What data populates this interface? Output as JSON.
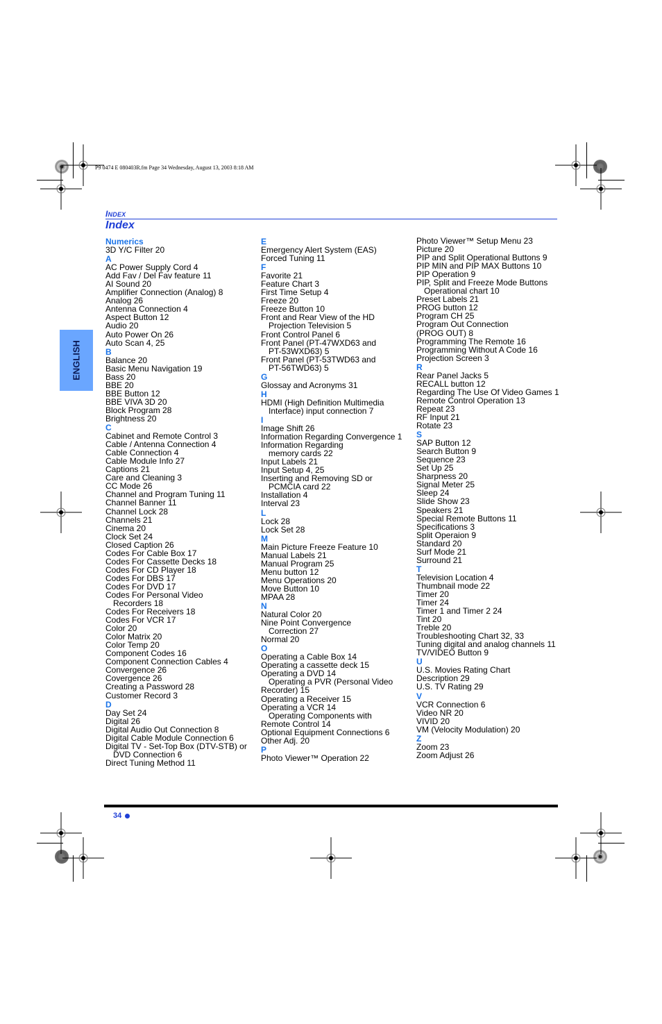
{
  "print_info": "P9 0474 E  080403R.fm  Page 34  Wednesday, August 13, 2003  8:18 AM",
  "header": {
    "section_label_initial": "I",
    "section_label_rest": "NDEX",
    "title": "Index"
  },
  "side_tab": {
    "label": "ENGLISH"
  },
  "colors": {
    "accent_blue": "#1f3fd6",
    "letter_blue": "#1a73e8",
    "tab_blue": "#6aa6ff"
  },
  "columns": [
    [
      {
        "t": "letter",
        "text": "Numerics"
      },
      {
        "t": "entry",
        "text": "3D Y/C Filter 20"
      },
      {
        "t": "letter",
        "text": "A"
      },
      {
        "t": "entry",
        "text": "AC Power Supply Cord 4"
      },
      {
        "t": "entry",
        "text": "Add Fav / Del Fav feature 11"
      },
      {
        "t": "entry",
        "text": "AI Sound 20"
      },
      {
        "t": "entry",
        "text": "Amplifier Connection (Analog) 8"
      },
      {
        "t": "entry",
        "text": "Analog 26"
      },
      {
        "t": "entry",
        "text": "Antenna Connection 4"
      },
      {
        "t": "entry",
        "text": "Aspect Button 12"
      },
      {
        "t": "entry",
        "text": "Audio 20"
      },
      {
        "t": "entry",
        "text": "Auto Power On 26"
      },
      {
        "t": "entry",
        "text": "Auto Scan 4, 25"
      },
      {
        "t": "letter",
        "text": "B"
      },
      {
        "t": "entry",
        "text": "Balance 20"
      },
      {
        "t": "entry",
        "text": "Basic Menu Navigation 19"
      },
      {
        "t": "entry",
        "text": "Bass 20"
      },
      {
        "t": "entry",
        "text": "BBE 20"
      },
      {
        "t": "entry",
        "text": "BBE Button 12"
      },
      {
        "t": "entry",
        "text": "BBE VIVA 3D 20"
      },
      {
        "t": "entry",
        "text": "Block Program 28"
      },
      {
        "t": "entry",
        "text": "Brightness 20"
      },
      {
        "t": "letter",
        "text": "C"
      },
      {
        "t": "entry",
        "text": "Cabinet and Remote Control 3"
      },
      {
        "t": "entry",
        "text": "Cable / Antenna Connection 4"
      },
      {
        "t": "entry",
        "text": "Cable Connection 4"
      },
      {
        "t": "entry",
        "text": "Cable Module Info 27"
      },
      {
        "t": "entry",
        "text": "Captions 21"
      },
      {
        "t": "entry",
        "text": "Care and Cleaning 3"
      },
      {
        "t": "entry",
        "text": "CC Mode 26"
      },
      {
        "t": "entry",
        "text": "Channel and Program Tuning 11"
      },
      {
        "t": "entry",
        "text": "Channel Banner 11"
      },
      {
        "t": "entry",
        "text": "Channel Lock 28"
      },
      {
        "t": "entry",
        "text": "Channels 21"
      },
      {
        "t": "entry",
        "text": "Cinema 20"
      },
      {
        "t": "entry",
        "text": "Clock Set 24"
      },
      {
        "t": "entry",
        "text": "Closed Caption 26"
      },
      {
        "t": "entry",
        "text": "Codes For Cable Box 17"
      },
      {
        "t": "entry",
        "text": "Codes For Cassette Decks 18"
      },
      {
        "t": "entry",
        "text": "Codes For CD Player 18"
      },
      {
        "t": "entry",
        "text": "Codes For DBS 17"
      },
      {
        "t": "entry",
        "text": "Codes For DVD 17"
      },
      {
        "t": "entry",
        "text": "Codes For Personal Video"
      },
      {
        "t": "cont",
        "text": "Recorders 18"
      },
      {
        "t": "entry",
        "text": "Codes For Receivers 18"
      },
      {
        "t": "entry",
        "text": "Codes For VCR 17"
      },
      {
        "t": "entry",
        "text": "Color 20"
      },
      {
        "t": "entry",
        "text": "Color Matrix 20"
      },
      {
        "t": "entry",
        "text": "Color Temp 20"
      },
      {
        "t": "entry",
        "text": "Component Codes 16"
      },
      {
        "t": "entry",
        "text": "Component Connection Cables 4"
      },
      {
        "t": "entry",
        "text": "Convergence 26"
      },
      {
        "t": "entry",
        "text": "Covergence 26"
      },
      {
        "t": "entry",
        "text": "Creating a Password 28"
      },
      {
        "t": "entry",
        "text": "Customer Record 3"
      },
      {
        "t": "letter",
        "text": "D"
      },
      {
        "t": "entry",
        "text": "Day Set 24"
      },
      {
        "t": "entry",
        "text": "Digital 26"
      },
      {
        "t": "entry",
        "text": "Digital Audio Out Connection 8"
      },
      {
        "t": "entry",
        "text": "Digital Cable Module Connection 6"
      },
      {
        "t": "entry",
        "text": "Digital TV - Set-Top Box (DTV-STB) or"
      },
      {
        "t": "cont",
        "text": "DVD Connection 6"
      },
      {
        "t": "entry",
        "text": "Direct Tuning Method 11"
      }
    ],
    [
      {
        "t": "letter",
        "text": "E"
      },
      {
        "t": "entry",
        "text": "Emergency Alert System (EAS)"
      },
      {
        "t": "entry",
        "text": "Forced Tuning 11"
      },
      {
        "t": "letter",
        "text": "F"
      },
      {
        "t": "entry",
        "text": "Favorite 21"
      },
      {
        "t": "entry",
        "text": "Feature Chart 3"
      },
      {
        "t": "entry",
        "text": "First Time Setup 4"
      },
      {
        "t": "entry",
        "text": "Freeze 20"
      },
      {
        "t": "entry",
        "text": "Freeze Button 10"
      },
      {
        "t": "entry",
        "text": "Front and Rear View of the HD"
      },
      {
        "t": "cont",
        "text": "Projection Television 5"
      },
      {
        "t": "entry",
        "text": "Front Control Panel 6"
      },
      {
        "t": "entry",
        "text": "Front Panel (PT-47WXD63 and"
      },
      {
        "t": "cont",
        "text": "PT-53WXD63) 5"
      },
      {
        "t": "entry",
        "text": "Front Panel (PT-53TWD63 and"
      },
      {
        "t": "cont",
        "text": "PT-56TWD63) 5"
      },
      {
        "t": "letter",
        "text": "G"
      },
      {
        "t": "entry",
        "text": "Glossay and Acronyms 31"
      },
      {
        "t": "letter",
        "text": "H"
      },
      {
        "t": "entry",
        "text": "HDMI (High Definition Multimedia"
      },
      {
        "t": "cont",
        "text": "Interface) input connection 7"
      },
      {
        "t": "letter",
        "text": "I"
      },
      {
        "t": "entry",
        "text": "Image Shift 26"
      },
      {
        "t": "entry",
        "text": "Information Regarding Convergence 1"
      },
      {
        "t": "entry",
        "text": "Information Regarding"
      },
      {
        "t": "cont",
        "text": "memory cards 22"
      },
      {
        "t": "entry",
        "text": "Input Labels 21"
      },
      {
        "t": "entry",
        "text": "Input Setup 4, 25"
      },
      {
        "t": "entry",
        "text": "Inserting and Removing SD or"
      },
      {
        "t": "cont",
        "text": "PCMCIA card 22"
      },
      {
        "t": "entry",
        "text": "Installation 4"
      },
      {
        "t": "entry",
        "text": "Interval 23"
      },
      {
        "t": "letter",
        "text": "L"
      },
      {
        "t": "entry",
        "text": "Lock 28"
      },
      {
        "t": "entry",
        "text": "Lock Set 28"
      },
      {
        "t": "letter",
        "text": "M"
      },
      {
        "t": "entry",
        "text": "Main Picture Freeze Feature 10"
      },
      {
        "t": "entry",
        "text": "Manual Labels 21"
      },
      {
        "t": "entry",
        "text": "Manual Program 25"
      },
      {
        "t": "entry",
        "text": "Menu button 12"
      },
      {
        "t": "entry",
        "text": "Menu Operations 20"
      },
      {
        "t": "entry",
        "text": "Move Button 10"
      },
      {
        "t": "entry",
        "text": "MPAA 28"
      },
      {
        "t": "letter",
        "text": "N"
      },
      {
        "t": "entry",
        "text": "Natural Color 20"
      },
      {
        "t": "entry",
        "text": "Nine Point Convergence"
      },
      {
        "t": "cont",
        "text": "Correction 27"
      },
      {
        "t": "entry",
        "text": "Normal 20"
      },
      {
        "t": "letter",
        "text": "O"
      },
      {
        "t": "entry",
        "text": "Operating a Cable Box 14"
      },
      {
        "t": "entry",
        "text": "Operating a cassette deck 15"
      },
      {
        "t": "entry",
        "text": "Operating a DVD 14"
      },
      {
        "t": "cont",
        "text": "Operating a PVR (Personal Video"
      },
      {
        "t": "entry",
        "text": "Recorder) 15"
      },
      {
        "t": "entry",
        "text": "Operating a Receiver 15"
      },
      {
        "t": "entry",
        "text": "Operating a VCR 14"
      },
      {
        "t": "cont",
        "text": "Operating Components with"
      },
      {
        "t": "entry",
        "text": "Remote Control 14"
      },
      {
        "t": "entry",
        "text": "Optional Equipment Connections 6"
      },
      {
        "t": "entry",
        "text": "Other Adj. 20"
      },
      {
        "t": "letter",
        "text": "P"
      },
      {
        "t": "entry",
        "text": "Photo Viewer™ Operation 22"
      }
    ],
    [
      {
        "t": "entry",
        "text": "Photo Viewer™ Setup Menu 23"
      },
      {
        "t": "entry",
        "text": "Picture 20"
      },
      {
        "t": "entry",
        "text": "PIP and Split Operational Buttons 9"
      },
      {
        "t": "entry",
        "text": "PIP MIN and PIP MAX Buttons 10"
      },
      {
        "t": "entry",
        "text": "PIP Operation 9"
      },
      {
        "t": "entry",
        "text": "PIP, Split and Freeze Mode Buttons"
      },
      {
        "t": "cont",
        "text": "Operational chart 10"
      },
      {
        "t": "entry",
        "text": "Preset Labels 21"
      },
      {
        "t": "entry",
        "text": "PROG button 12"
      },
      {
        "t": "entry",
        "text": "Program CH 25"
      },
      {
        "t": "entry",
        "text": "Program Out Connection"
      },
      {
        "t": "entry",
        "text": "(PROG OUT) 8"
      },
      {
        "t": "entry",
        "text": "Programming The Remote 16"
      },
      {
        "t": "entry",
        "text": "Programming Without A Code 16"
      },
      {
        "t": "entry",
        "text": "Projection Screen 3"
      },
      {
        "t": "letter",
        "text": "R"
      },
      {
        "t": "entry",
        "text": "Rear Panel Jacks 5"
      },
      {
        "t": "entry",
        "text": "RECALL button 12"
      },
      {
        "t": "entry",
        "text": "Regarding The Use Of Video Games 1"
      },
      {
        "t": "entry",
        "text": "Remote Control Operation 13"
      },
      {
        "t": "entry",
        "text": "Repeat 23"
      },
      {
        "t": "entry",
        "text": "RF Input 21"
      },
      {
        "t": "entry",
        "text": "Rotate 23"
      },
      {
        "t": "letter",
        "text": "S"
      },
      {
        "t": "entry",
        "text": "SAP Button 12"
      },
      {
        "t": "entry",
        "text": "Search Button 9"
      },
      {
        "t": "entry",
        "text": "Sequence 23"
      },
      {
        "t": "entry",
        "text": "Set Up 25"
      },
      {
        "t": "entry",
        "text": "Sharpness 20"
      },
      {
        "t": "entry",
        "text": "Signal Meter 25"
      },
      {
        "t": "entry",
        "text": "Sleep 24"
      },
      {
        "t": "entry",
        "text": "Slide Show 23"
      },
      {
        "t": "entry",
        "text": "Speakers 21"
      },
      {
        "t": "entry",
        "text": "Special Remote Buttons 11"
      },
      {
        "t": "entry",
        "text": "Specifications 3"
      },
      {
        "t": "entry",
        "text": "Split Operaion 9"
      },
      {
        "t": "entry",
        "text": "Standard 20"
      },
      {
        "t": "entry",
        "text": "Surf Mode 21"
      },
      {
        "t": "entry",
        "text": "Surround 21"
      },
      {
        "t": "letter",
        "text": "T"
      },
      {
        "t": "entry",
        "text": "Television Location 4"
      },
      {
        "t": "entry",
        "text": "Thumbnail mode 22"
      },
      {
        "t": "entry",
        "text": "Timer 20"
      },
      {
        "t": "entry",
        "text": "Timer 24"
      },
      {
        "t": "entry",
        "text": "Timer 1 and Timer 2 24"
      },
      {
        "t": "entry",
        "text": "Tint 20"
      },
      {
        "t": "entry",
        "text": "Treble 20"
      },
      {
        "t": "entry",
        "text": "Troubleshooting Chart 32, 33"
      },
      {
        "t": "entry",
        "text": "Tuning digital and analog channels 11"
      },
      {
        "t": "entry",
        "text": "TV/VIDEO Button 9"
      },
      {
        "t": "letter",
        "text": "U"
      },
      {
        "t": "entry",
        "text": "U.S. Movies Rating Chart"
      },
      {
        "t": "entry",
        "text": "Description 29"
      },
      {
        "t": "entry",
        "text": "U.S. TV Rating 29"
      },
      {
        "t": "letter",
        "text": "V"
      },
      {
        "t": "entry",
        "text": "VCR Connection 6"
      },
      {
        "t": "entry",
        "text": "Video NR 20"
      },
      {
        "t": "entry",
        "text": "VIVID 20"
      },
      {
        "t": "entry",
        "text": "VM (Velocity Modulation) 20"
      },
      {
        "t": "letter",
        "text": "Z"
      },
      {
        "t": "entry",
        "text": "Zoom 23"
      },
      {
        "t": "entry",
        "text": "Zoom Adjust 26"
      }
    ]
  ],
  "footer": {
    "page_number": "34"
  }
}
